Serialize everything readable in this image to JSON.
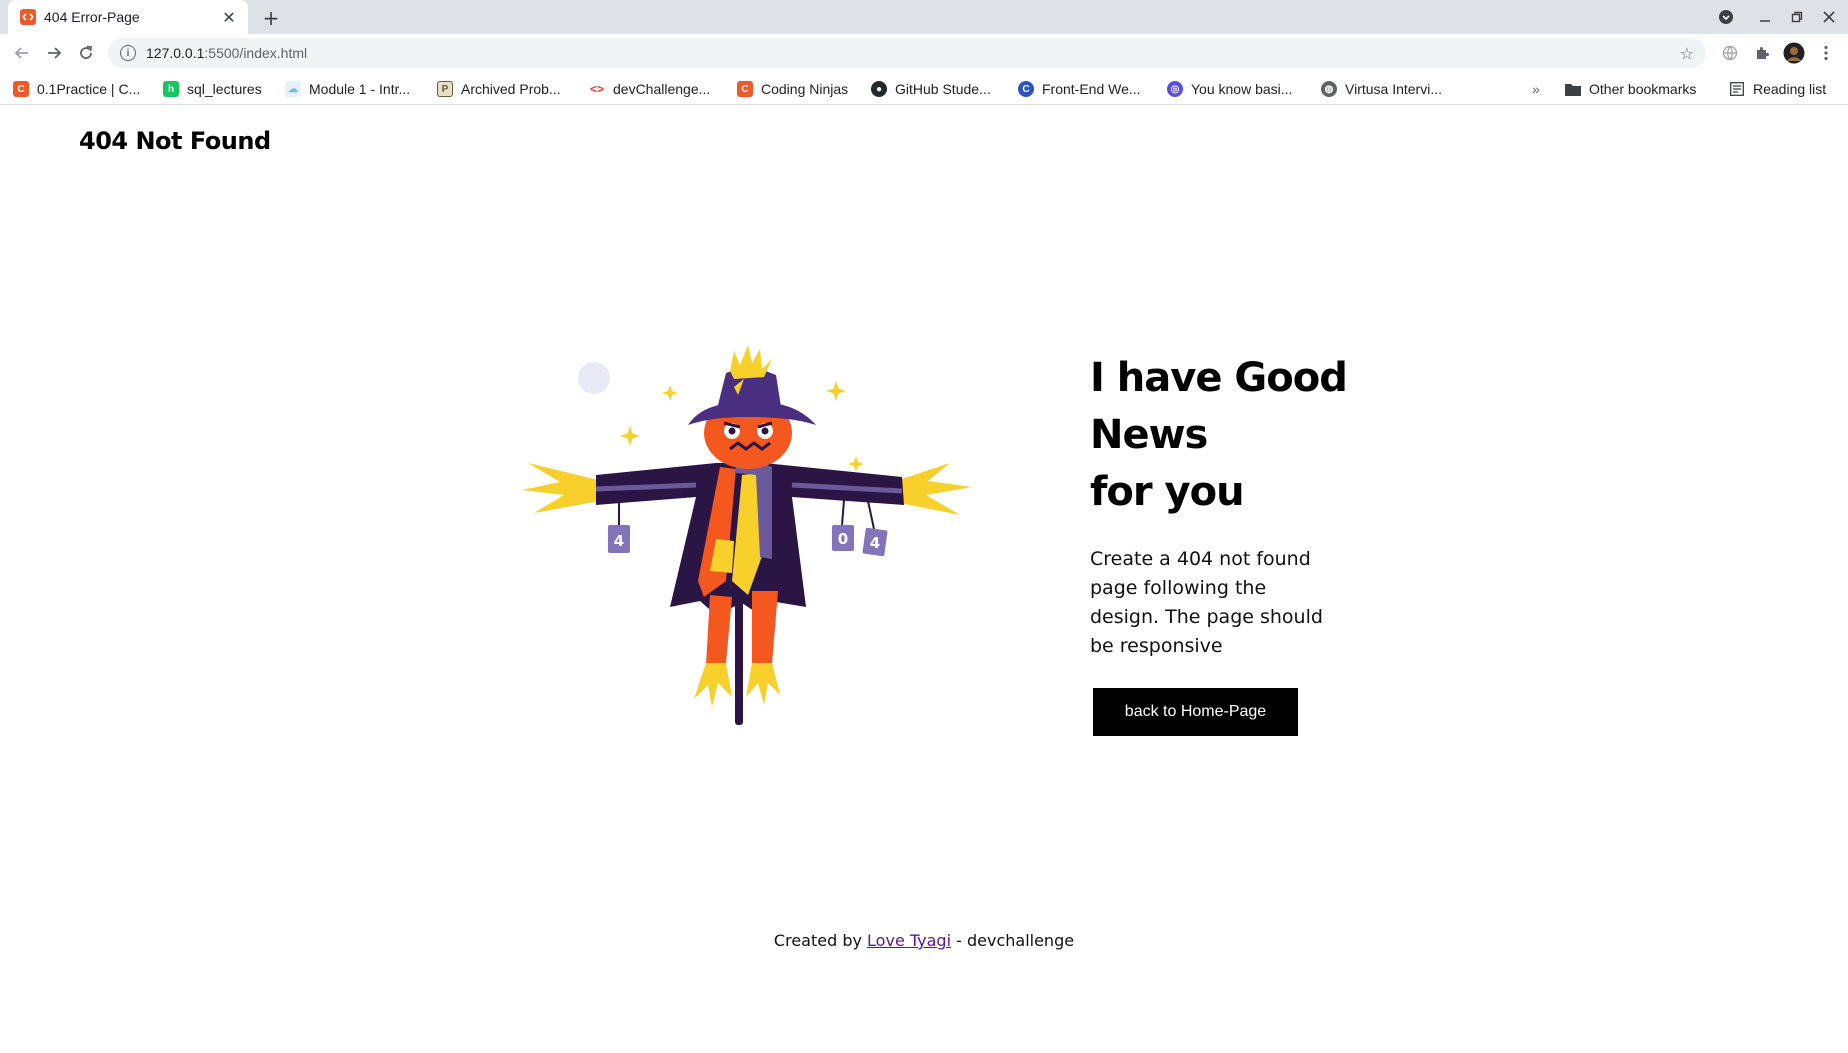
{
  "browser": {
    "tab": {
      "title": "404 Error-Page"
    },
    "address": {
      "host": "127.0.0.1",
      "rest": ":5500/index.html"
    },
    "bookmarks": [
      {
        "label": "0.1Practice | C...",
        "icon": "coding-ninjas-icon",
        "color": "#f1592a"
      },
      {
        "label": "sql_lectures",
        "icon": "hackerrank-icon",
        "color": "#16c75f"
      },
      {
        "label": "Module 1 - Intr...",
        "icon": "cloud-icon",
        "color": "#7fb6d9"
      },
      {
        "label": "Archived Prob...",
        "icon": "project-euler-icon",
        "color": "#6b5a3a"
      },
      {
        "label": "devChallenge...",
        "icon": "devchallenges-icon",
        "color": "#e53935"
      },
      {
        "label": "Coding Ninjas",
        "icon": "coding-ninjas-icon",
        "color": "#f1592a"
      },
      {
        "label": "GitHub Stude...",
        "icon": "github-icon",
        "color": "#24292e"
      },
      {
        "label": "Front-End We...",
        "icon": "coursera-icon",
        "color": "#2a53c8"
      },
      {
        "label": "You know basi...",
        "icon": "circle-app-icon",
        "color": "#5b4cf0"
      },
      {
        "label": "Virtusa Intervi...",
        "icon": "globe-icon",
        "color": "#5f6368"
      }
    ],
    "more_bookmarks": "»",
    "other_bookmarks": "Other bookmarks",
    "reading_list": "Reading list"
  },
  "page": {
    "brand": "404 Not Found",
    "headline_lines": [
      "I have Good",
      "News",
      "for you"
    ],
    "description": "Create a 404 not found page following the design. The page should be responsive",
    "cta_label": "back to Home-Page",
    "footer": {
      "prefix": "Created by ",
      "author": "Love Tyagi",
      "suffix": " - devchallenge"
    },
    "colors": {
      "button_bg": "#000000",
      "link": "#551a8b",
      "hat": "#4a2f80",
      "coat": "#2b1545",
      "pumpkin": "#f4581f",
      "straw": "#f7d02b"
    }
  }
}
